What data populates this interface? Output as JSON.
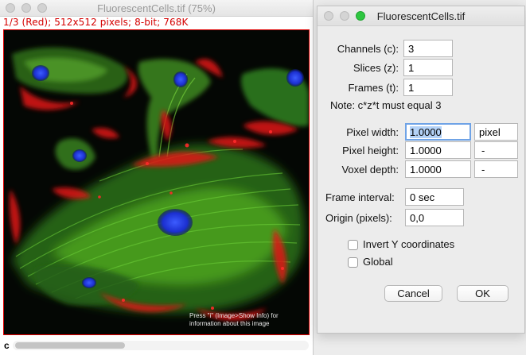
{
  "image_window": {
    "title": "FluorescentCells.tif (75%)",
    "info": "1/3 (Red); 512x512 pixels; 8-bit; 768K",
    "overlay_text": "Press \"i\" (Image>Show Info) for information about this image",
    "channel_label": "c"
  },
  "dialog": {
    "title": "FluorescentCells.tif",
    "fields": {
      "channels": {
        "label": "Channels (c):",
        "value": "3"
      },
      "slices": {
        "label": "Slices (z):",
        "value": "1"
      },
      "frames": {
        "label": "Frames (t):",
        "value": "1"
      },
      "pixel_width": {
        "label": "Pixel width:",
        "value": "1.0000",
        "unit": "pixel"
      },
      "pixel_height": {
        "label": "Pixel height:",
        "value": "1.0000",
        "unit": "-"
      },
      "voxel_depth": {
        "label": "Voxel depth:",
        "value": "1.0000",
        "unit": "-"
      },
      "frame_interval": {
        "label": "Frame interval:",
        "value": "0 sec"
      },
      "origin": {
        "label": "Origin (pixels):",
        "value": "0,0"
      }
    },
    "note": "Note: c*z*t must equal 3",
    "checkboxes": {
      "invert_y": {
        "label": "Invert Y coordinates",
        "checked": false
      },
      "global": {
        "label": "Global",
        "checked": false
      }
    },
    "buttons": {
      "cancel": "Cancel",
      "ok": "OK"
    }
  },
  "colors": {
    "info_text": "#d40000",
    "image_border": "#e00000",
    "focus_ring": "#6fa3e6",
    "maximize_button": "#2ec640"
  }
}
